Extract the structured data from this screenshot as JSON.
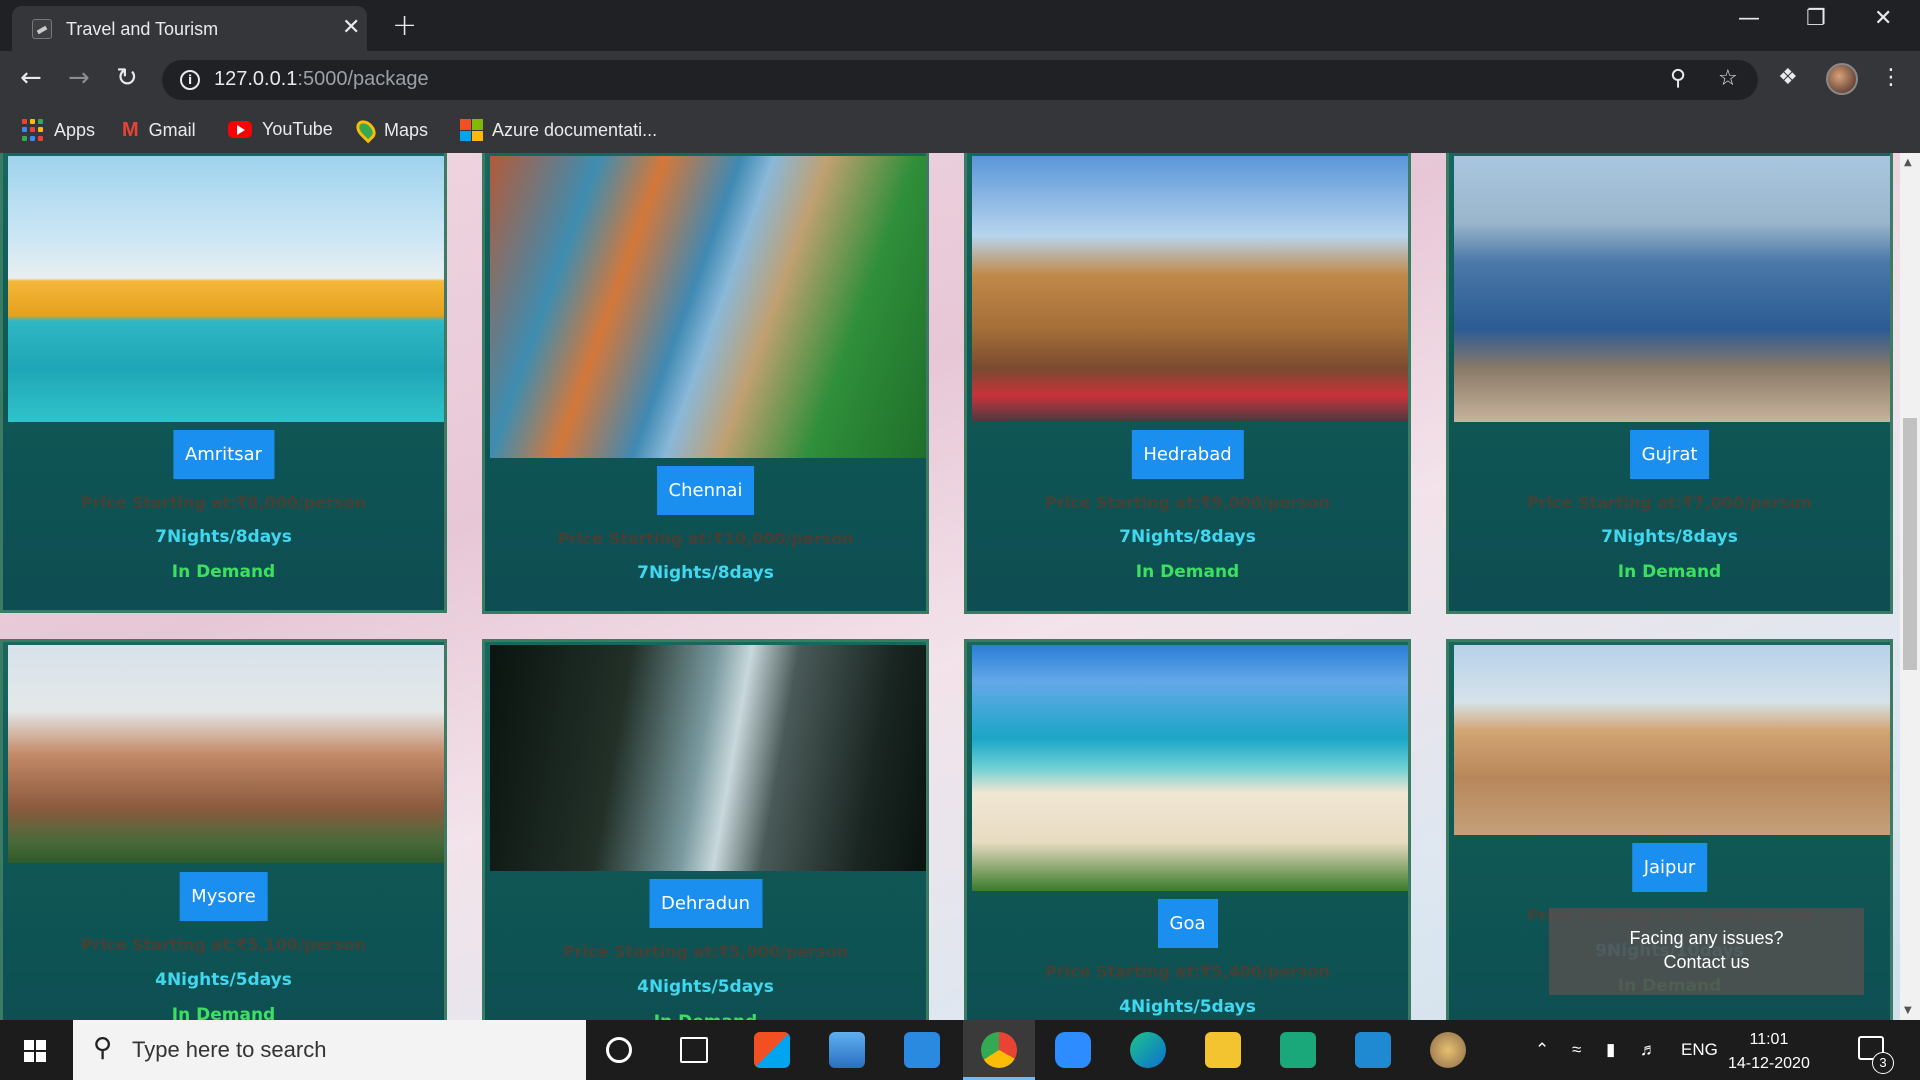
{
  "browser": {
    "tab_title": "Travel and Tourism",
    "tab_close": "✕",
    "new_tab": "+",
    "url_host": "127.0.0.1",
    "url_path": ":5000/package",
    "window_controls": {
      "minimize": "—",
      "restore": "❐",
      "close": "✕"
    }
  },
  "bookmarks": [
    {
      "label": "Apps",
      "icon": "apps-grid-icon"
    },
    {
      "label": "Gmail",
      "icon": "gmail-icon"
    },
    {
      "label": "YouTube",
      "icon": "youtube-icon"
    },
    {
      "label": "Maps",
      "icon": "maps-icon"
    },
    {
      "label": "Azure documentati...",
      "icon": "microsoft-icon"
    }
  ],
  "packages": [
    {
      "city": "Amritsar",
      "price": "Price Starting at:₹8,000/person",
      "duration": "7Nights/8days",
      "status": "In Demand"
    },
    {
      "city": "Chennai",
      "price": "Price Starting at:₹10,000/person",
      "duration": "7Nights/8days",
      "status": ""
    },
    {
      "city": "Hedrabad",
      "price": "Price Starting at:₹9,000/person",
      "duration": "7Nights/8days",
      "status": "In Demand"
    },
    {
      "city": "Gujrat",
      "price": "Price Starting at:₹7,000/person",
      "duration": "7Nights/8days",
      "status": "In Demand"
    },
    {
      "city": "Mysore",
      "price": "Price Starting at:₹5,100/person",
      "duration": "4Nights/5days",
      "status": "In Demand"
    },
    {
      "city": "Dehradun",
      "price": "Price Starting at:₹5,000/person",
      "duration": "4Nights/5days",
      "status": "In Demand"
    },
    {
      "city": "Goa",
      "price": "Price Starting at:₹5,400/person",
      "duration": "4Nights/5days",
      "status": ""
    },
    {
      "city": "Jaipur",
      "price": "Price Starting at:₹7,000/person",
      "duration": "9Nights/10days",
      "status": "In Demand"
    }
  ],
  "contact": {
    "line1": "Facing any issues?",
    "line2": "Contact us"
  },
  "taskbar": {
    "search_placeholder": "Type here to search",
    "language": "ENG",
    "time": "11:01",
    "date": "14-12-2020",
    "notification_count": "3"
  },
  "colors": {
    "accent": "#1a8ff0",
    "card_bg": "#0f5a55",
    "duration_text": "#40d8f0",
    "demand_text": "#3ce060"
  }
}
